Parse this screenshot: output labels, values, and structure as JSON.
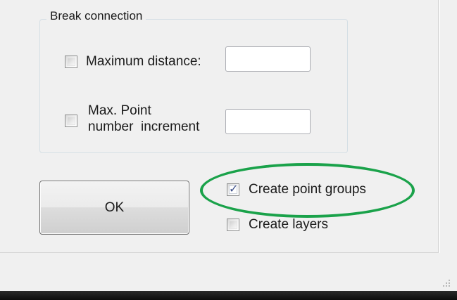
{
  "break_connection": {
    "title": "Break connection",
    "max_distance": {
      "label": "Maximum distance:",
      "checked": false,
      "value": ""
    },
    "max_point_increment": {
      "label_line1": "Max. Point",
      "label_line2": "number  increment",
      "checked": false,
      "value": ""
    }
  },
  "actions": {
    "ok_label": "OK"
  },
  "options": {
    "create_point_groups": {
      "label": "Create point groups",
      "checked": true
    },
    "create_layers": {
      "label": "Create layers",
      "checked": false
    }
  },
  "icons": {
    "check": "checkmark-icon",
    "grip": "resize-grip-icon"
  },
  "colors": {
    "highlight": "#1aa24a",
    "check_mark": "#3d4f8a",
    "background": "#f0f0f0"
  }
}
